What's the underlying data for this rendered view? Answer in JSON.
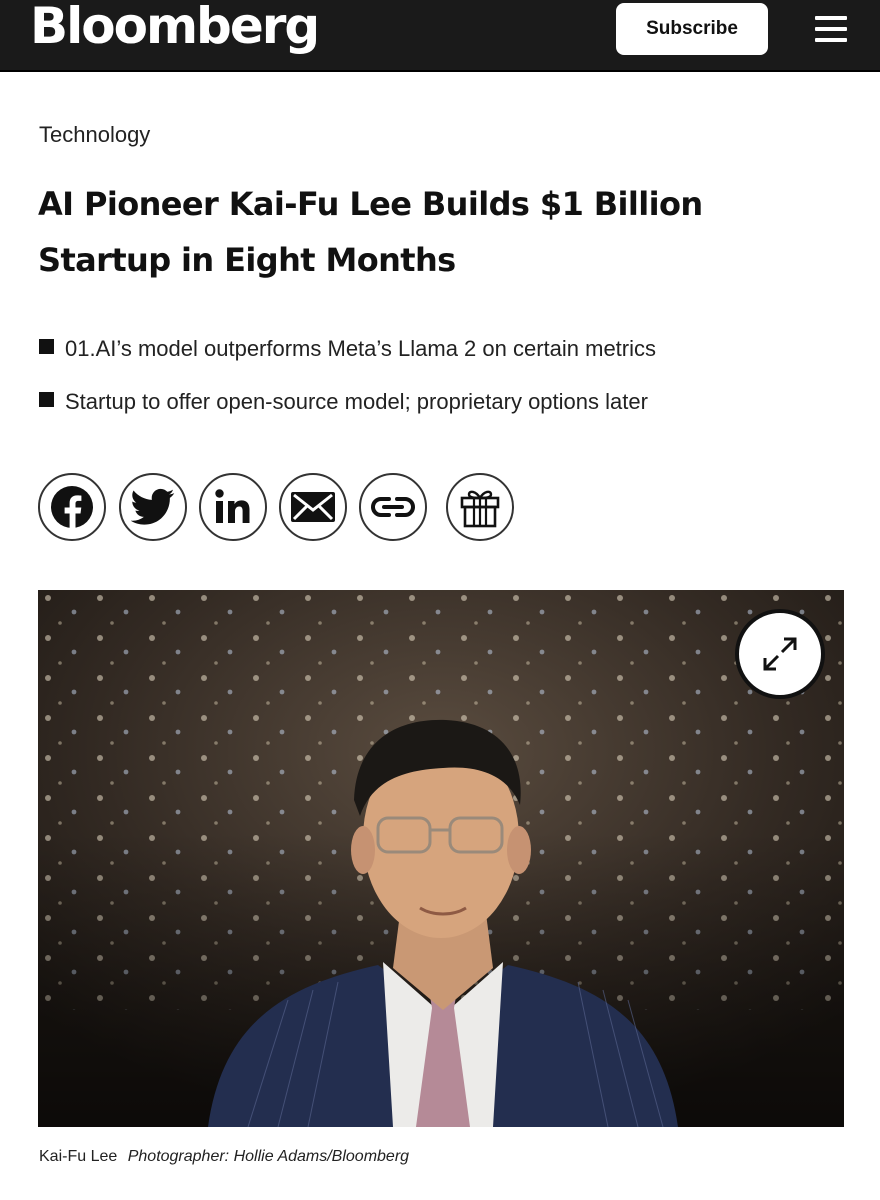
{
  "header": {
    "logo": "Bloomberg",
    "subscribe_label": "Subscribe",
    "menu_icon": "hamburger-menu-icon",
    "background_color": "#1a1a1a"
  },
  "article": {
    "section": "Technology",
    "headline": "AI Pioneer Kai-Fu Lee Builds $1 Billion Startup in Eight Months",
    "bullets": [
      "01.AI’s model outperforms Meta’s Llama 2 on certain metrics",
      "Startup to offer open-source model; proprietary options later"
    ]
  },
  "share": {
    "icons": [
      "facebook-icon",
      "twitter-icon",
      "linkedin-icon",
      "email-icon",
      "link-icon",
      "gift-icon"
    ]
  },
  "photo": {
    "expand_icon": "expand-icon",
    "caption_name": "Kai-Fu Lee",
    "caption_credit": "Photographer: Hollie Adams/Bloomberg"
  }
}
